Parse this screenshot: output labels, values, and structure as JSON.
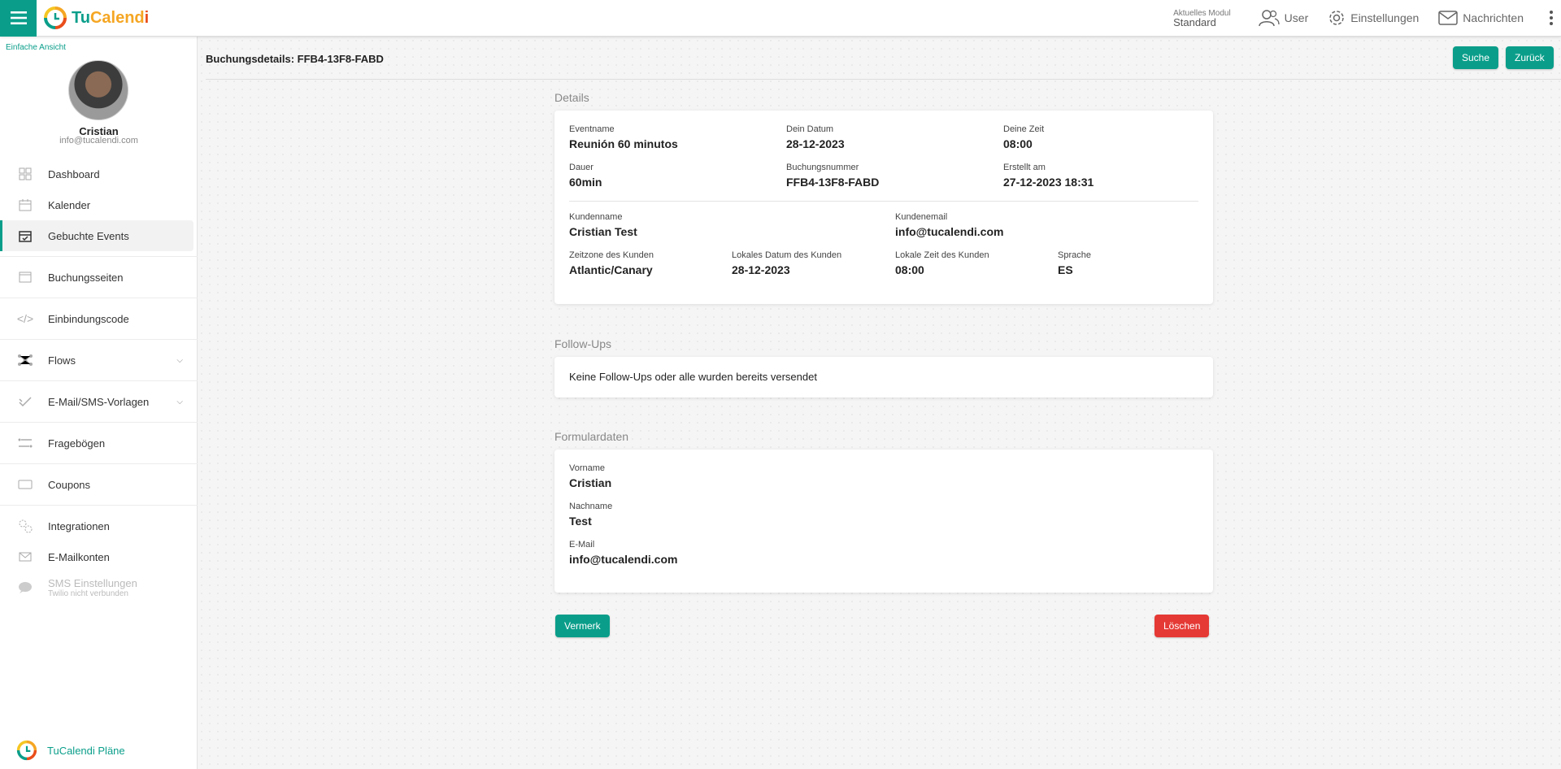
{
  "app": {
    "logo_tu": "Tu",
    "logo_cal": "Calend",
    "logo_i": "i"
  },
  "topbar": {
    "modul_label": "Aktuelles Modul",
    "modul_value": "Standard",
    "user": "User",
    "settings": "Einstellungen",
    "messages": "Nachrichten"
  },
  "sidebar": {
    "simple_view": "Einfache Ansicht",
    "user_name": "Cristian",
    "user_email": "info@tucalendi.com",
    "items": [
      {
        "label": "Dashboard",
        "icon": "grid-icon"
      },
      {
        "label": "Kalender",
        "icon": "calendar-icon"
      },
      {
        "label": "Gebuchte Events",
        "icon": "calendar-check-icon",
        "active": true
      },
      {
        "label": "Buchungsseiten",
        "icon": "window-icon"
      },
      {
        "label": "Einbindungscode",
        "icon": "code-icon"
      },
      {
        "label": "Flows",
        "icon": "flow-icon"
      },
      {
        "label": "E-Mail/SMS-Vorlagen",
        "icon": "check-double-icon"
      },
      {
        "label": "Fragebögen",
        "icon": "questionnaire-icon"
      },
      {
        "label": "Coupons",
        "icon": "ticket-icon"
      },
      {
        "label": "Integrationen",
        "icon": "gears-icon"
      },
      {
        "label": "E-Mailkonten",
        "icon": "envelope-icon"
      },
      {
        "label": "SMS Einstellungen",
        "sub": "Twilio nicht verbunden",
        "icon": "chat-icon"
      }
    ],
    "plans": "TuCalendi Pläne"
  },
  "main": {
    "title": "Buchungsdetails: FFB4-13F8-FABD",
    "search_button": "Suche",
    "back_button": "Zurück",
    "details_title": "Details",
    "details": {
      "event_label": "Eventname",
      "event_value": "Reunión 60 minutos",
      "date_label": "Dein Datum",
      "date_value": "28-12-2023",
      "time_label": "Deine Zeit",
      "time_value": "08:00",
      "duration_label": "Dauer",
      "duration_value": "60min",
      "booking_label": "Buchungsnummer",
      "booking_value": "FFB4-13F8-FABD",
      "created_label": "Erstellt am",
      "created_value": "27-12-2023 18:31",
      "customer_label": "Kundenname",
      "customer_value": "Cristian Test",
      "cemail_label": "Kundenemail",
      "cemail_value": "info@tucalendi.com",
      "tz_label": "Zeitzone des Kunden",
      "tz_value": "Atlantic/Canary",
      "ldate_label": "Lokales Datum des Kunden",
      "ldate_value": "28-12-2023",
      "ltime_label": "Lokale Zeit des Kunden",
      "ltime_value": "08:00",
      "lang_label": "Sprache",
      "lang_value": "ES"
    },
    "followups_title": "Follow-Ups",
    "followups_text": "Keine Follow-Ups oder alle wurden bereits versendet",
    "form_title": "Formulardaten",
    "form": {
      "first_label": "Vorname",
      "first_value": "Cristian",
      "last_label": "Nachname",
      "last_value": "Test",
      "email_label": "E-Mail",
      "email_value": "info@tucalendi.com"
    },
    "note_button": "Vermerk",
    "delete_button": "Löschen"
  },
  "colors": {
    "accent": "#0a9e8a",
    "danger": "#e53935"
  }
}
